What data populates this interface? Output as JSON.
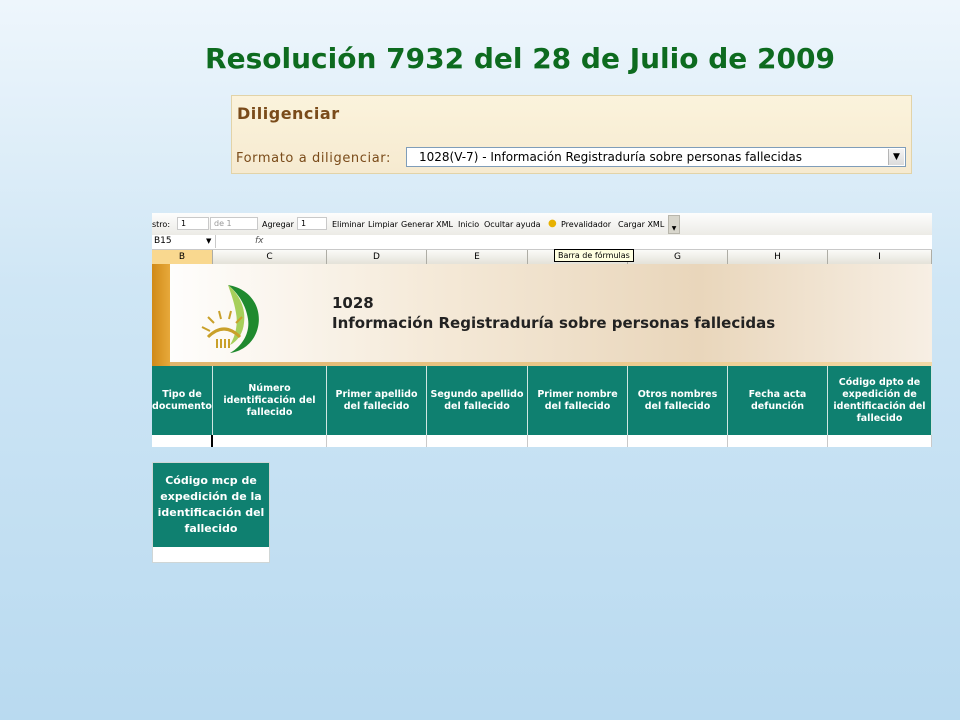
{
  "slide": {
    "title": "Resolución 7932 del 28 de Julio de 2009"
  },
  "diligenciar": {
    "heading": "Diligenciar",
    "label": "Formato a diligenciar:",
    "selected": "1028(V-7) - Información Registraduría sobre personas fallecidas"
  },
  "toolbar": {
    "registro_label": "stro:",
    "registro_value": "1",
    "de_value": "de 1",
    "agregar_label": "Agregar",
    "agregar_value": "1",
    "eliminar": "Eliminar",
    "limpiar": "Limpiar",
    "generar_xml": "Generar XML",
    "inicio": "Inicio",
    "ocultar_ayuda": "Ocultar ayuda",
    "prevalidador": "Prevalidador",
    "cargar_xml": "Cargar XML"
  },
  "formula_bar": {
    "cell_ref": "B15",
    "fx": "fx",
    "tooltip": "Barra de fórmulas"
  },
  "columns": [
    "B",
    "C",
    "D",
    "E",
    "F",
    "G",
    "H",
    "I"
  ],
  "banner": {
    "code": "1028",
    "name": "Información Registraduría sobre personas fallecidas"
  },
  "table_headers": [
    "Tipo de documento",
    "Número identificación del fallecido",
    "Primer apellido del fallecido",
    "Segundo apellido del fallecido",
    "Primer nombre del fallecido",
    "Otros nombres del fallecido",
    "Fecha acta defunción",
    "Código dpto de expedición de identificación del fallecido"
  ],
  "extra_header": "Código mcp de expedición de la identificación del fallecido",
  "colors": {
    "title_green": "#0d6b1f",
    "header_teal": "#0f8070",
    "banner_orange": "#d08a18",
    "label_brown": "#7a4b1a"
  }
}
